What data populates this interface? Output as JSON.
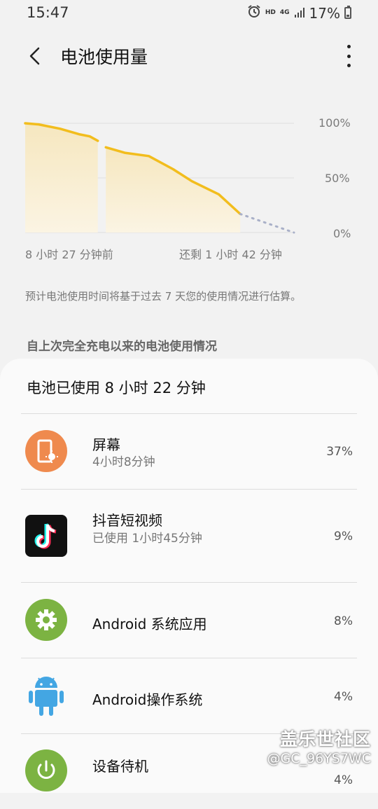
{
  "status": {
    "time": "15:47",
    "hd": "HD",
    "net": "4G",
    "battery": "17%"
  },
  "header": {
    "title": "电池使用量"
  },
  "chart": {
    "y_ticks": [
      "100%",
      "50%",
      "0%"
    ],
    "start_label": "8 小时 27 分钟前",
    "end_label": "还剩 1 小时 42 分钟"
  },
  "chart_data": {
    "type": "area",
    "ylim": [
      0,
      100
    ],
    "series": [
      {
        "x": [
          0,
          0.05,
          0.13,
          0.2,
          0.24,
          0.27
        ],
        "values": [
          100,
          99,
          95,
          90,
          88,
          84
        ]
      },
      {
        "x": [
          0.3,
          0.37,
          0.46,
          0.55,
          0.62,
          0.72,
          0.8
        ],
        "values": [
          78,
          73,
          70,
          58,
          47,
          35,
          17
        ]
      },
      {
        "x": [
          0.8,
          1.0
        ],
        "values": [
          17,
          0
        ],
        "style": "dotted-forecast"
      }
    ]
  },
  "note": "预计电池使用时间将基于过去 7 天您的使用情况进行估算。",
  "section_title": "自上次完全充电以来的电池使用情况",
  "usage": {
    "title": "电池已使用 8 小时 22 分钟",
    "items": [
      {
        "name": "屏幕",
        "sub": "4小时8分钟",
        "pct": "37%",
        "icon": "screen-icon",
        "color": "#ef8a4e"
      },
      {
        "name": "抖音短视频",
        "sub": "已使用 1小时45分钟",
        "pct": "9%",
        "icon": "tiktok-icon",
        "color": "#111111"
      },
      {
        "name": "Android 系统应用",
        "sub": "",
        "pct": "8%",
        "icon": "gear-icon",
        "color": "#7cb342"
      },
      {
        "name": "Android操作系统",
        "sub": "",
        "pct": "4%",
        "icon": "android-icon",
        "color": "#43a6e3"
      },
      {
        "name": "设备待机",
        "sub": "",
        "pct": "4%",
        "icon": "power-icon",
        "color": "#7cb342"
      }
    ]
  },
  "watermark": {
    "line1": "盖乐世社区",
    "line2": "@GC_96YS7WC"
  }
}
